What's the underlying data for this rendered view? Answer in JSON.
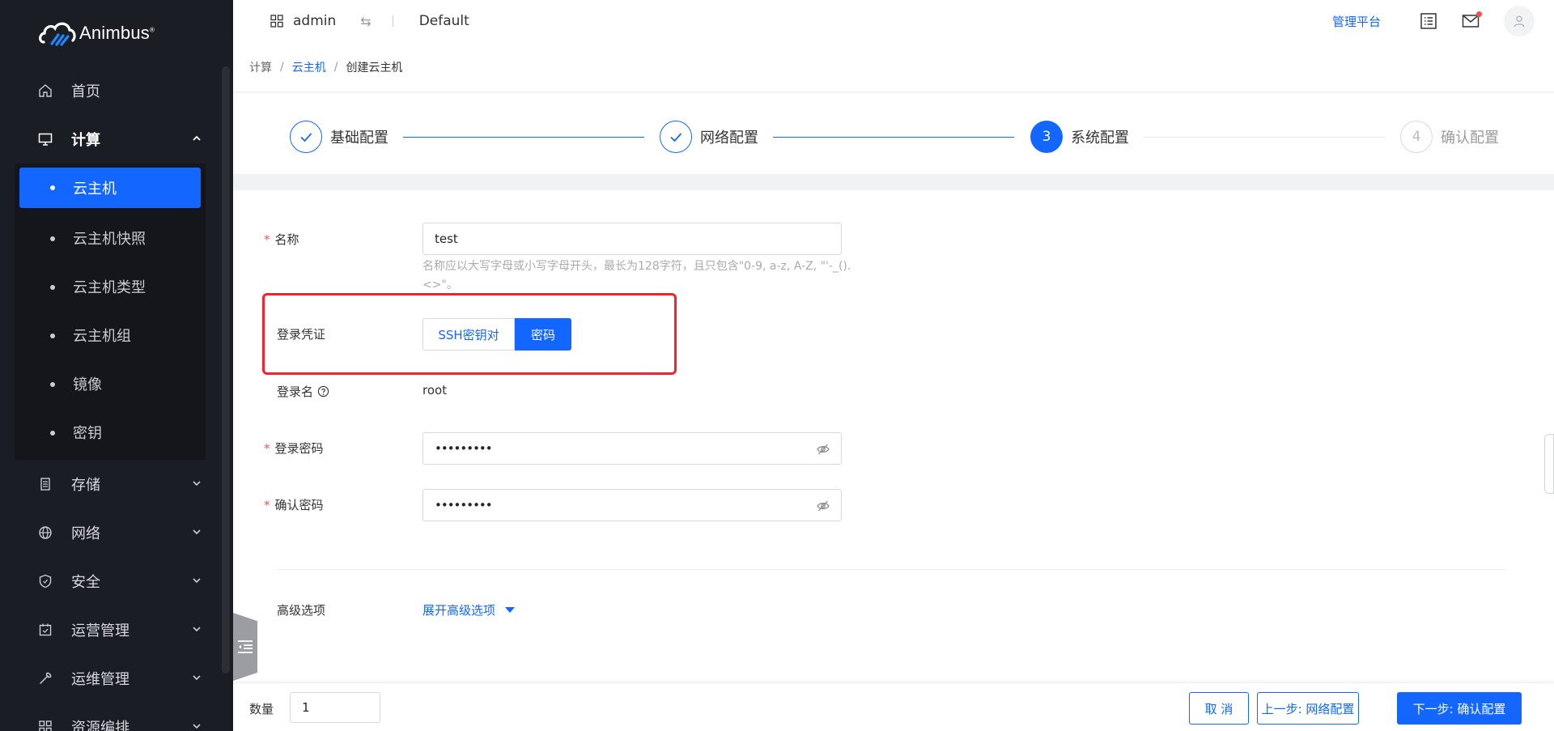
{
  "brand": {
    "name": "Animbus",
    "reg": "®"
  },
  "sidebar": {
    "items": [
      {
        "label": "首页",
        "icon": "home-icon"
      },
      {
        "label": "计算",
        "icon": "monitor-icon",
        "open": true
      },
      {
        "label": "存储",
        "icon": "storage-icon"
      },
      {
        "label": "网络",
        "icon": "globe-icon"
      },
      {
        "label": "安全",
        "icon": "shield-icon"
      },
      {
        "label": "运营管理",
        "icon": "calendar-icon"
      },
      {
        "label": "运维管理",
        "icon": "wrench-icon"
      },
      {
        "label": "资源编排",
        "icon": "grid-icon"
      }
    ],
    "compute_sub": [
      {
        "label": "云主机",
        "active": true
      },
      {
        "label": "云主机快照"
      },
      {
        "label": "云主机类型"
      },
      {
        "label": "云主机组"
      },
      {
        "label": "镜像"
      },
      {
        "label": "密钥"
      }
    ]
  },
  "topbar": {
    "user": "admin",
    "project": "Default",
    "admin_link": "管理平台"
  },
  "breadcrumb": {
    "root": "计算",
    "parent": "云主机",
    "current": "创建云主机"
  },
  "steps": [
    {
      "num": "",
      "label": "基础配置",
      "state": "done"
    },
    {
      "num": "",
      "label": "网络配置",
      "state": "done"
    },
    {
      "num": "3",
      "label": "系统配置",
      "state": "current"
    },
    {
      "num": "4",
      "label": "确认配置",
      "state": "wait"
    }
  ],
  "form": {
    "name_label": "名称",
    "name_value": "test",
    "name_hint": "名称应以大写字母或小写字母开头，最长为128字符，且只包含\"0-9, a-z, A-Z, \"'-_().<>\"。",
    "credential_label": "登录凭证",
    "credential_options": [
      "SSH密钥对",
      "密码"
    ],
    "credential_selected": "密码",
    "login_name_label": "登录名",
    "login_name_value": "root",
    "password_label": "登录密码",
    "password_value": "•••••••••",
    "confirm_label": "确认密码",
    "confirm_value": "•••••••••",
    "advanced_label": "高级选项",
    "advanced_link": "展开高级选项"
  },
  "footer": {
    "qty_label": "数量",
    "qty_value": "1",
    "cancel": "取 消",
    "prev": "上一步: 网络配置",
    "next": "下一步: 确认配置"
  },
  "colors": {
    "primary": "#1366ff",
    "danger": "#f5222d",
    "sidebar_bg": "#1b1d24"
  }
}
